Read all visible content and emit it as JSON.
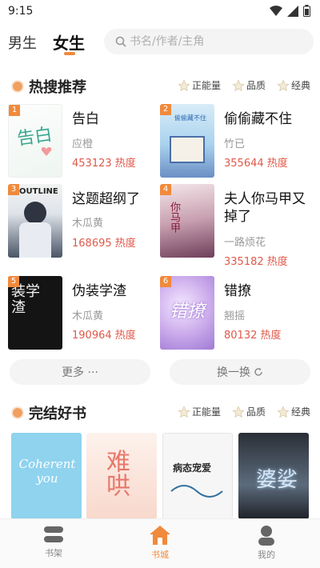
{
  "status_bar": {
    "time": "9:15"
  },
  "top_bar": {
    "tabs": [
      {
        "label": "男生",
        "active": false
      },
      {
        "label": "女生",
        "active": true
      }
    ],
    "search": {
      "placeholder": "书名/作者/主角"
    }
  },
  "filters": [
    "正能量",
    "品质",
    "经典"
  ],
  "hot_section": {
    "title": "热搜推荐",
    "books": [
      {
        "rank": "1",
        "title": "告白",
        "author": "应橙",
        "heat": "453123 热度",
        "cover_text": "告白"
      },
      {
        "rank": "2",
        "title": "偷偷藏不住",
        "author": "竹已",
        "heat": "355644 热度",
        "cover_text": "偷偷藏不住"
      },
      {
        "rank": "3",
        "title": "这题超纲了",
        "author": "木瓜黄",
        "heat": "168695 热度",
        "cover_text": "OUTLINE"
      },
      {
        "rank": "4",
        "title": "夫人你马甲又掉了",
        "author": "一路烦花",
        "heat": "335182 热度",
        "cover_text": "你马甲"
      },
      {
        "rank": "5",
        "title": "伪装学渣",
        "author": "木瓜黄",
        "heat": "190964 热度",
        "cover_text": "装学渣"
      },
      {
        "rank": "6",
        "title": "错撩",
        "author": "翘摇",
        "heat": "80132 热度",
        "cover_text": "错撩"
      }
    ],
    "more_label": "更多 ···",
    "refresh_label": "换一换"
  },
  "finished_section": {
    "title": "完结好书",
    "covers": [
      "Coherent you",
      "难哄",
      "病态宠爱",
      "婆娑"
    ]
  },
  "tab_bar": {
    "items": [
      {
        "label": "书架",
        "active": false
      },
      {
        "label": "书城",
        "active": true
      },
      {
        "label": "我的",
        "active": false
      }
    ]
  },
  "colors": {
    "accent": "#f08a3c",
    "heat": "#e0584a"
  }
}
